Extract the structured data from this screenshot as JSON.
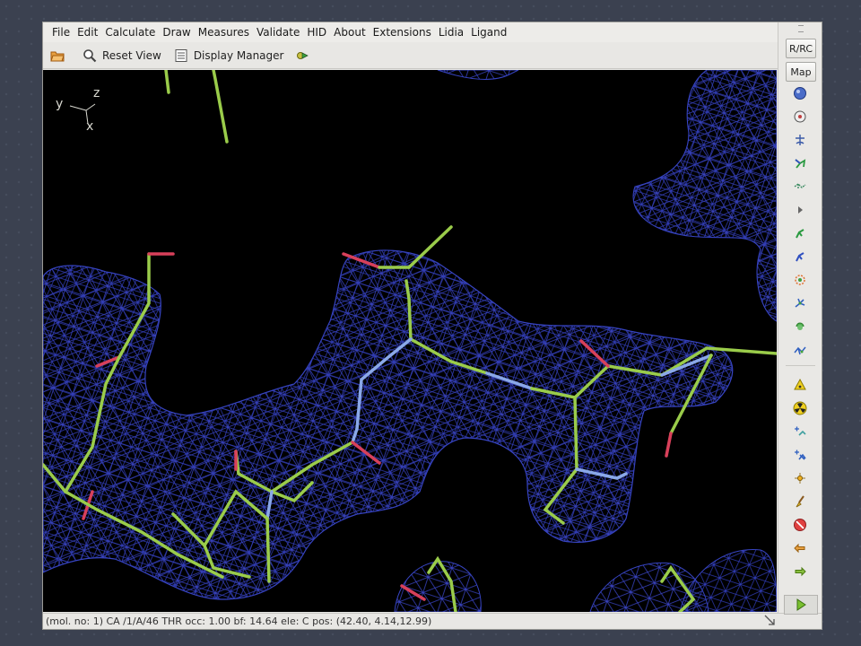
{
  "menu": {
    "items": [
      "File",
      "Edit",
      "Calculate",
      "Draw",
      "Measures",
      "Validate",
      "HID",
      "About",
      "Extensions",
      "Lidia",
      "Ligand"
    ]
  },
  "toolbar": {
    "open_icon": "folder-open-icon",
    "reset_view_label": "Reset View",
    "display_manager_label": "Display Manager",
    "extra_icon": "arrow-right-icon"
  },
  "axes": {
    "y": "y",
    "z": "z",
    "x": "x"
  },
  "status": {
    "text": "(mol. no: 1)  CA /1/A/46 THR occ:  1.00 bf: 14.64 ele:  C pos: (42.40, 4.14,12.99)"
  },
  "side": {
    "rrc_label": "R/RC",
    "map_label": "Map",
    "icons": [
      "refine-sphere-icon",
      "rotate-translate-icon",
      "auto-fit-rotamer-icon",
      "flip-peptide-icon",
      "side-chain-icon",
      "play-small-icon",
      "add-residue-icon",
      "add-alt-conf-icon",
      "ligand-fit-icon",
      "rigid-body-icon",
      "pepflip-icon",
      "regularize-icon",
      "warning-icon",
      "radiation-icon",
      "place-atom-icon",
      "delete-atom-icon",
      "pointer-icon",
      "paint-brush-icon",
      "stop-icon",
      "undo-icon",
      "redo-icon"
    ]
  },
  "colors": {
    "mesh": "#3340c8",
    "carbon": "#9acc4a",
    "nitrogen": "#8aa8e8",
    "oxygen": "#d8405a",
    "background": "#000000"
  }
}
